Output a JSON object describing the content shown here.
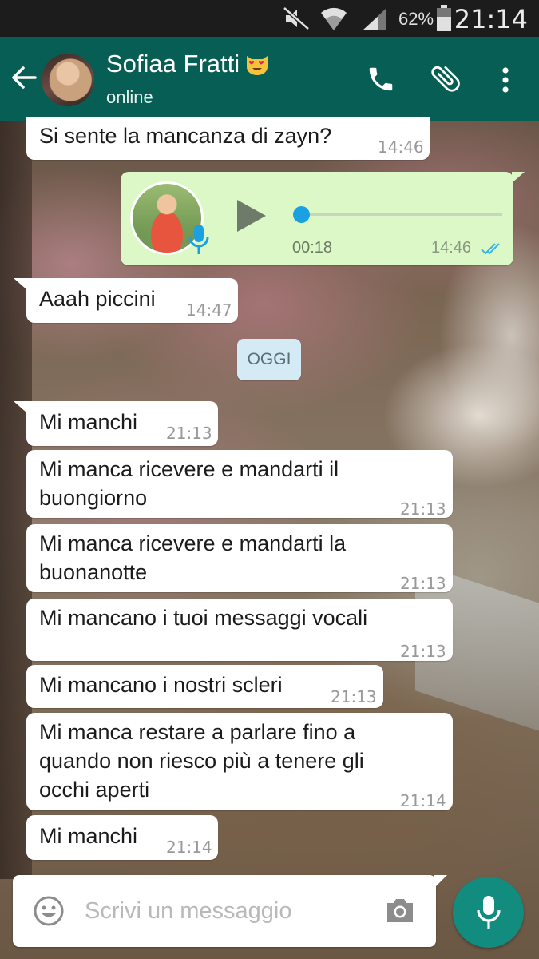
{
  "status_bar": {
    "battery_percent": "62%",
    "time": "21:14",
    "icons": [
      "mute-icon",
      "wifi-icon",
      "signal-icon",
      "battery-icon"
    ]
  },
  "header": {
    "contact_name": "Sofiaa Fratti",
    "contact_emoji": "heart-eyes-cat-emoji",
    "status": "online",
    "icons": [
      "back-arrow-icon",
      "phone-icon",
      "attach-icon",
      "more-vert-icon"
    ],
    "color": "#075e54"
  },
  "messages": [
    {
      "type": "text",
      "direction": "in",
      "text": "Si sente la mancanza di zayn?",
      "time": "14:46"
    },
    {
      "type": "voice",
      "direction": "out",
      "duration": "00:18",
      "time": "14:46",
      "status": "read"
    },
    {
      "type": "text",
      "direction": "in",
      "text": "Aaah piccini",
      "time": "14:47"
    },
    {
      "type": "date",
      "label": "OGGI"
    },
    {
      "type": "text",
      "direction": "in",
      "text": "Mi manchi",
      "time": "21:13"
    },
    {
      "type": "text",
      "direction": "in",
      "lines": [
        "Mi manca ricevere e mandarti il",
        "buongiorno"
      ],
      "time": "21:13"
    },
    {
      "type": "text",
      "direction": "in",
      "lines": [
        "Mi manca ricevere e mandarti la",
        "buonanotte"
      ],
      "time": "21:13"
    },
    {
      "type": "text",
      "direction": "in",
      "text": "Mi mancano i tuoi messaggi vocali",
      "time": "21:13"
    },
    {
      "type": "text",
      "direction": "in",
      "text": "Mi mancano i nostri scleri",
      "time": "21:13"
    },
    {
      "type": "text",
      "direction": "in",
      "lines": [
        "Mi manca restare a parlare fino a",
        "quando non riesco più a tenere gli",
        "occhi aperti"
      ],
      "time": "21:14"
    },
    {
      "type": "text",
      "direction": "in",
      "text": "Mi manchi",
      "time": "21:14"
    }
  ],
  "composer": {
    "placeholder": "Scrivi un messaggio",
    "icons": [
      "emoji-icon",
      "camera-icon",
      "mic-icon"
    ]
  },
  "colors": {
    "accent": "#128c7e",
    "outgoing_bubble": "#dcf8c6",
    "read_ticks": "#34b7f1",
    "date_chip": "#d4eaf4"
  }
}
